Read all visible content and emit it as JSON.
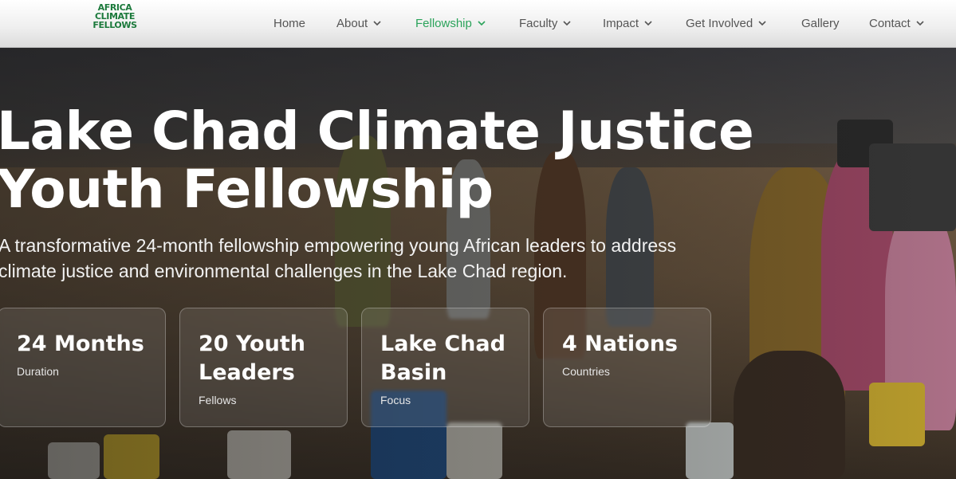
{
  "logo": {
    "lines": [
      "AFRICA",
      "CLIMATE",
      "FELLOWS"
    ]
  },
  "nav": {
    "items": [
      {
        "label": "Home",
        "has_dropdown": false,
        "active": false
      },
      {
        "label": "About",
        "has_dropdown": true,
        "active": false
      },
      {
        "label": "Fellowship",
        "has_dropdown": true,
        "active": true
      },
      {
        "label": "Faculty",
        "has_dropdown": true,
        "active": false
      },
      {
        "label": "Impact",
        "has_dropdown": true,
        "active": false
      },
      {
        "label": "Get Involved",
        "has_dropdown": true,
        "active": false
      },
      {
        "label": "Gallery",
        "has_dropdown": false,
        "active": false
      },
      {
        "label": "Contact",
        "has_dropdown": true,
        "active": false
      }
    ]
  },
  "hero": {
    "title_line1": "Lake Chad Climate Justice",
    "title_line2": "Youth Fellowship",
    "subtitle_line1": "A transformative 24-month fellowship empowering young African leaders to address",
    "subtitle_line2": "climate justice and environmental challenges in the Lake Chad region."
  },
  "stats": [
    {
      "value": "24 Months",
      "label": "Duration"
    },
    {
      "value": "20 Youth Leaders",
      "label": "Fellows"
    },
    {
      "value": "Lake Chad Basin",
      "label": "Focus"
    },
    {
      "value": "4 Nations",
      "label": "Countries"
    }
  ],
  "colors": {
    "accent": "#2aa35a",
    "logo": "#1c7a3c",
    "nav_text": "#555555"
  }
}
